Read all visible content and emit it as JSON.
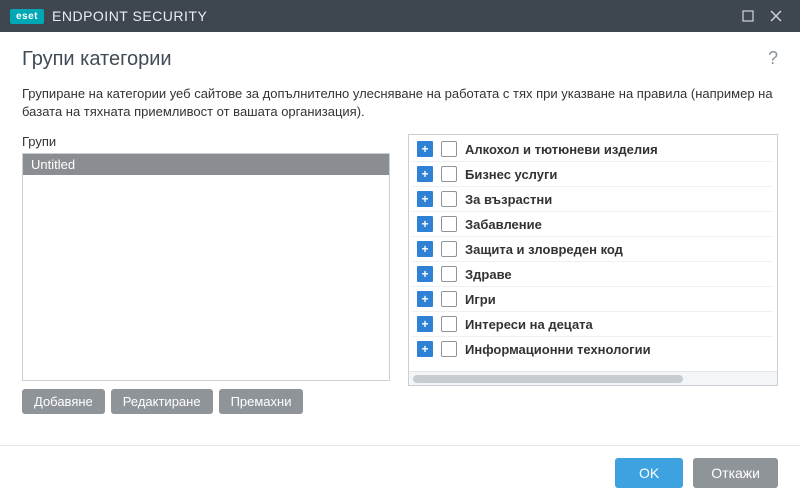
{
  "brand": "eset",
  "product_light": "ENDPOINT ",
  "product_bold": "SECURITY",
  "page_title": "Групи категории",
  "description": "Групиране на категории уеб сайтове за допълнително улесняване на работата с тях при указване на правила (например на базата на тяхната приемливост от вашата организация).",
  "groups_label": "Групи",
  "groups": {
    "items": [
      {
        "label": "Untitled",
        "selected": true
      }
    ]
  },
  "buttons": {
    "add": "Добавяне",
    "edit": "Редактиране",
    "remove": "Премахни",
    "ok": "OK",
    "cancel": "Откажи"
  },
  "categories": [
    {
      "label": "Алкохол и тютюневи изделия"
    },
    {
      "label": "Бизнес услуги"
    },
    {
      "label": "За възрастни"
    },
    {
      "label": "Забавление"
    },
    {
      "label": "Защита и зловреден код"
    },
    {
      "label": "Здраве"
    },
    {
      "label": "Игри"
    },
    {
      "label": "Интереси на децата"
    },
    {
      "label": "Информационни технологии"
    }
  ]
}
